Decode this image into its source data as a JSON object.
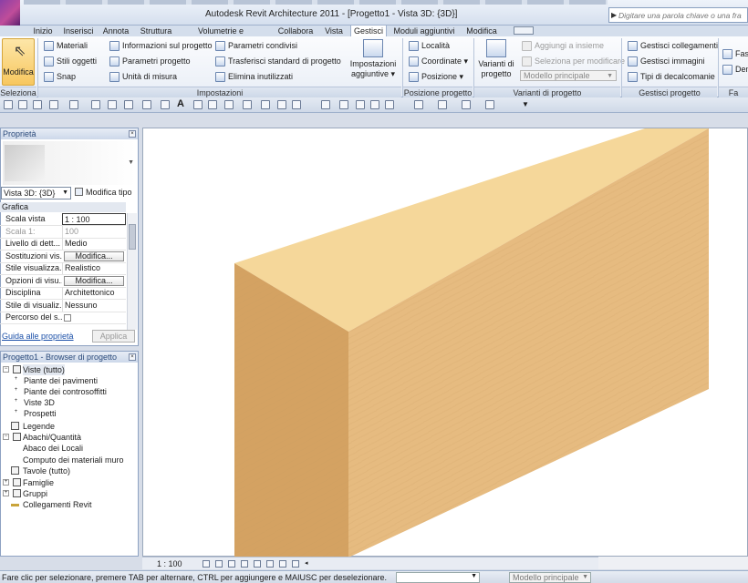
{
  "window": {
    "title": "Autodesk Revit Architecture 2011 - [Progetto1 - Vista 3D: {3D}]",
    "search_placeholder": "Digitare una parola chiave o una fra"
  },
  "tabs": [
    "Inizio",
    "Inserisci",
    "Annota",
    "Struttura",
    "Volumetrie e planimetria",
    "Collabora",
    "Vista",
    "Gestisci",
    "Moduli aggiuntivi",
    "Modifica"
  ],
  "active_tab": "Gestisci",
  "ribbon": {
    "modifica": "Modifica",
    "panels": {
      "seleziona": "Seleziona",
      "impostazioni": "Impostazioni",
      "posizione_progetto": "Posizione progetto",
      "varianti_progetto": "Varianti di progetto",
      "gestisci_progetto": "Gestisci progetto",
      "fasi": "Fa"
    },
    "impostazioni_col1": [
      "Materiali",
      "Stili oggetti",
      "Snap"
    ],
    "impostazioni_col2": [
      "Informazioni sul progetto",
      "Parametri progetto",
      "Unità di misura"
    ],
    "impostazioni_col3": [
      "Parametri condivisi",
      "Trasferisci standard di progetto",
      "Elimina inutilizzati"
    ],
    "impostazioni_aggiuntive": "Impostazioni aggiuntive",
    "posizione": [
      "Località",
      "Coordinate",
      "Posizione"
    ],
    "varianti": "Varianti di progetto",
    "varianti_disabled": [
      "Aggiungi a insieme",
      "Seleziona per modificare"
    ],
    "model_dropdown": "Modello principale",
    "gestisci": [
      "Gestisci collegamenti",
      "Gestisci immagini",
      "Tipi di decalcomanie"
    ],
    "fasi_items": [
      "Fasi",
      "Dem"
    ]
  },
  "properties": {
    "header": "Proprietà",
    "view_selector": "Vista 3D: {3D}",
    "edit_type": "Modifica tipo",
    "section": "Grafica",
    "rows": [
      {
        "key": "Scala vista",
        "value": "1 : 100"
      },
      {
        "key": "Scala  1:",
        "value": "100"
      },
      {
        "key": "Livello di dett...",
        "value": "Medio"
      },
      {
        "key": "Sostituzioni vis...",
        "value": "Modifica..."
      },
      {
        "key": "Stile visualizza...",
        "value": "Realistico"
      },
      {
        "key": "Opzioni di visu...",
        "value": "Modifica..."
      },
      {
        "key": "Disciplina",
        "value": "Architettonico"
      },
      {
        "key": "Stile di visualiz...",
        "value": "Nessuno"
      },
      {
        "key": "Percorso del s...",
        "value": ""
      }
    ],
    "help_link": "Guida alle proprietà",
    "apply": "Applica"
  },
  "browser": {
    "header": "Progetto1 - Browser di progetto",
    "nodes": [
      {
        "label": "Viste (tutto)",
        "level": 0
      },
      {
        "label": "Piante dei pavimenti",
        "level": 1
      },
      {
        "label": "Piante dei controsoffitti",
        "level": 1
      },
      {
        "label": "Viste 3D",
        "level": 1
      },
      {
        "label": "Prospetti",
        "level": 1
      },
      {
        "label": "Legende",
        "level": 0
      },
      {
        "label": "Abachi/Quantità",
        "level": 0
      },
      {
        "label": "Abaco dei Locali",
        "level": 1
      },
      {
        "label": "Computo dei materiali muro",
        "level": 1
      },
      {
        "label": "Tavole (tutto)",
        "level": 0
      },
      {
        "label": "Famiglie",
        "level": 0
      },
      {
        "label": "Gruppi",
        "level": 0
      },
      {
        "label": "Collegamenti Revit",
        "level": 0
      }
    ]
  },
  "view_control": {
    "scale": "1 : 100"
  },
  "status": {
    "message": "Fare clic per selezionare, premere TAB per alternare, CTRL per aggiungere e MAIUSC per deselezionare.",
    "model": "Modello principale"
  },
  "colors": {
    "wood_top": "#f5d79a",
    "wood_front": "#e4b87a",
    "wood_side": "#d9a86a",
    "ribbon_bg": "#e9eef6"
  }
}
